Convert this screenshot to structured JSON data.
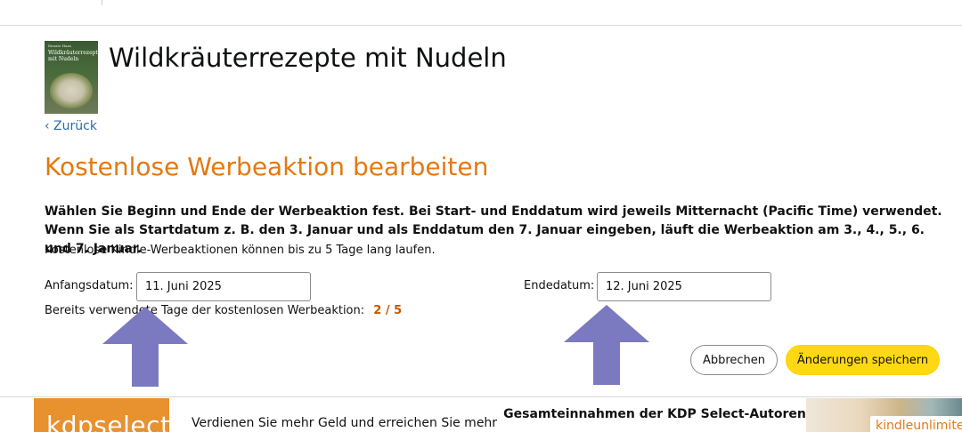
{
  "book": {
    "title": "Wildkräuterrezepte mit Nudeln",
    "cover": {
      "author_text": "Renate Haas",
      "title_text": "Wildkräuterrezepte mit Nudeln"
    }
  },
  "nav": {
    "back_label": "‹ Zurück"
  },
  "page": {
    "title": "Kostenlose Werbeaktion bearbeiten",
    "instructions": "Wählen Sie Beginn und Ende der Werbeaktion fest. Bei Start- und Enddatum wird jeweils Mitternacht (Pacific Time) verwendet. Wenn Sie als Startdatum z. B. den 3. Januar und als Enddatum den 7. Januar eingeben, läuft die Werbeaktion am 3., 4., 5., 6. und 7. Januar.",
    "max_days_note": "Kostenlose Kindle-Werbeaktionen können bis zu 5 Tage lang laufen."
  },
  "form": {
    "start": {
      "label": "Anfangsdatum:",
      "value": "11. Juni 2025"
    },
    "end": {
      "label": "Endedatum:",
      "value": "12. Juni 2025"
    },
    "used_days_label": "Bereits verwendete Tage der kostenlosen Werbeaktion:",
    "used_days_value": "2 / 5"
  },
  "actions": {
    "cancel_label": "Abbrechen",
    "save_label": "Änderungen speichern"
  },
  "banner": {
    "logo_text": "kdpselect",
    "text": "Verdienen Sie mehr Geld und erreichen Sie mehr",
    "heading": "Gesamteinnahmen der KDP Select-Autoren",
    "badge_text": "kindleunlimited"
  },
  "colors": {
    "heading_orange": "#e47911",
    "link_blue": "#2b6ca3",
    "count_orange": "#c45500",
    "save_yellow": "#ffd814",
    "arrow_purple": "#7b7ac0",
    "kdp_orange": "#e8912f"
  }
}
